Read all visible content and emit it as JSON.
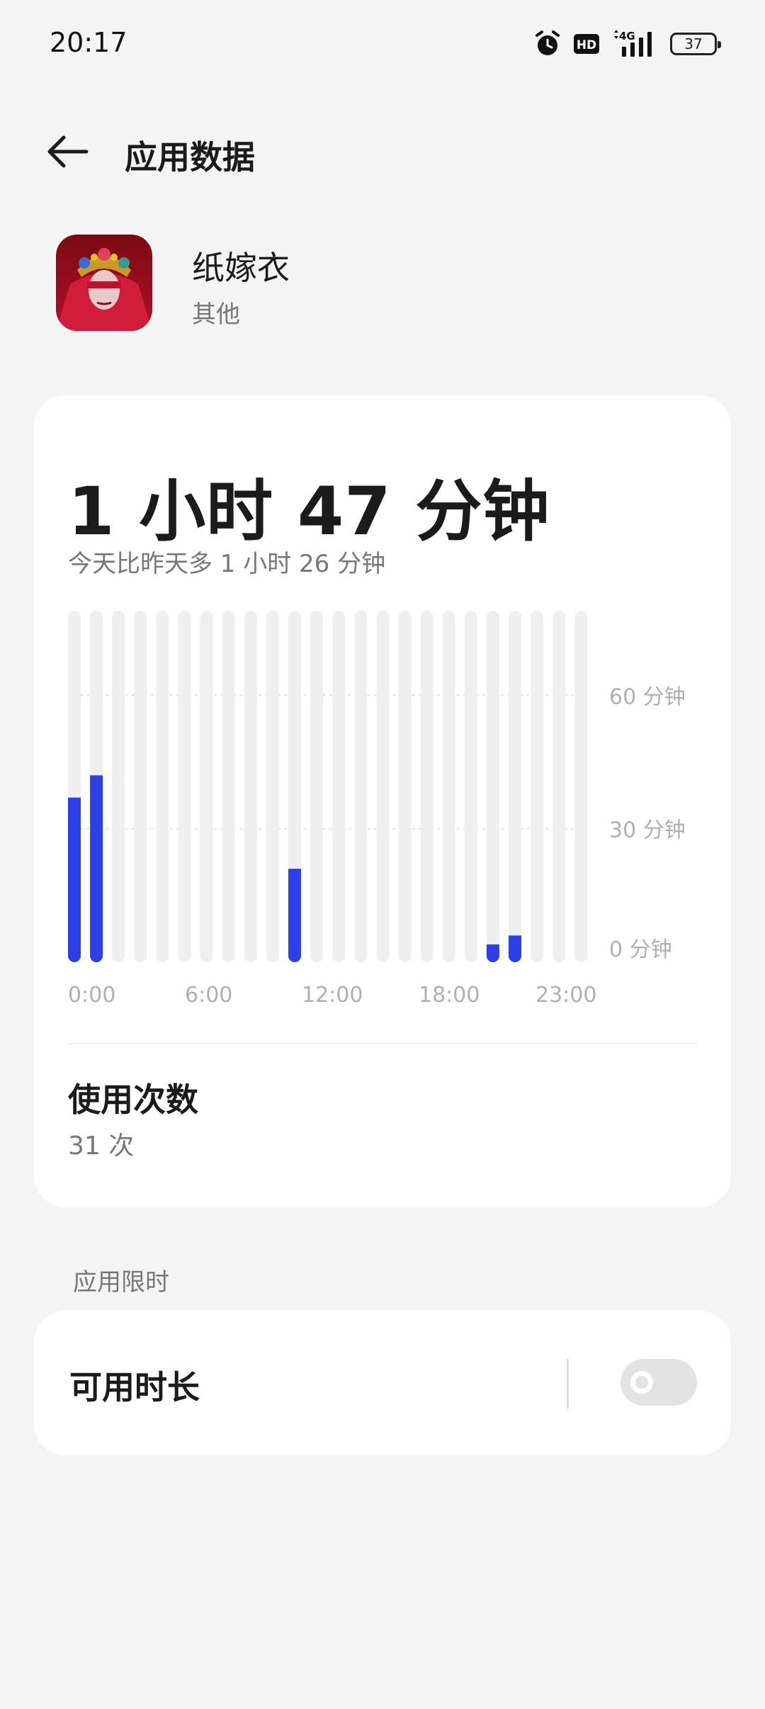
{
  "status_bar": {
    "time": "20:17",
    "hd": "HD",
    "network": "4G",
    "battery": "37",
    "icons": [
      "alarm-icon",
      "hd-icon",
      "4g-signal-icon",
      "battery-icon"
    ]
  },
  "header": {
    "title": "应用数据",
    "back_icon": "back-arrow-icon"
  },
  "app": {
    "name": "纸嫁衣",
    "category": "其他"
  },
  "usage": {
    "total_time": "1 小时 47 分钟",
    "comparison": "今天比昨天多 1 小时 26 分钟",
    "count_label": "使用次数",
    "count_value": "31 次"
  },
  "chart_data": {
    "type": "bar",
    "x": [
      0,
      1,
      2,
      3,
      4,
      5,
      6,
      7,
      8,
      9,
      10,
      11,
      12,
      13,
      14,
      15,
      16,
      17,
      18,
      19,
      20,
      21,
      22,
      23
    ],
    "x_tick_labels": [
      "0:00",
      "6:00",
      "12:00",
      "18:00",
      "23:00"
    ],
    "values": [
      37,
      42,
      0,
      0,
      0,
      0,
      0,
      0,
      0,
      0,
      21,
      0,
      0,
      0,
      0,
      0,
      0,
      0,
      0,
      4,
      6,
      0,
      0,
      0
    ],
    "y_tick_labels": [
      "60 分钟",
      "30 分钟",
      "0 分钟"
    ],
    "y_ticks": [
      60,
      30,
      0
    ],
    "ylim": [
      0,
      79
    ],
    "grid": "horizontal-dotted",
    "bar_color": "#2f3fe6",
    "track_color": "#efefef"
  },
  "limits": {
    "section_label": "应用限时",
    "available_label": "可用时长",
    "toggle_on": false
  },
  "colors": {
    "accent": "#2f3fe6",
    "background": "#f4f4f4",
    "card": "#ffffff"
  }
}
